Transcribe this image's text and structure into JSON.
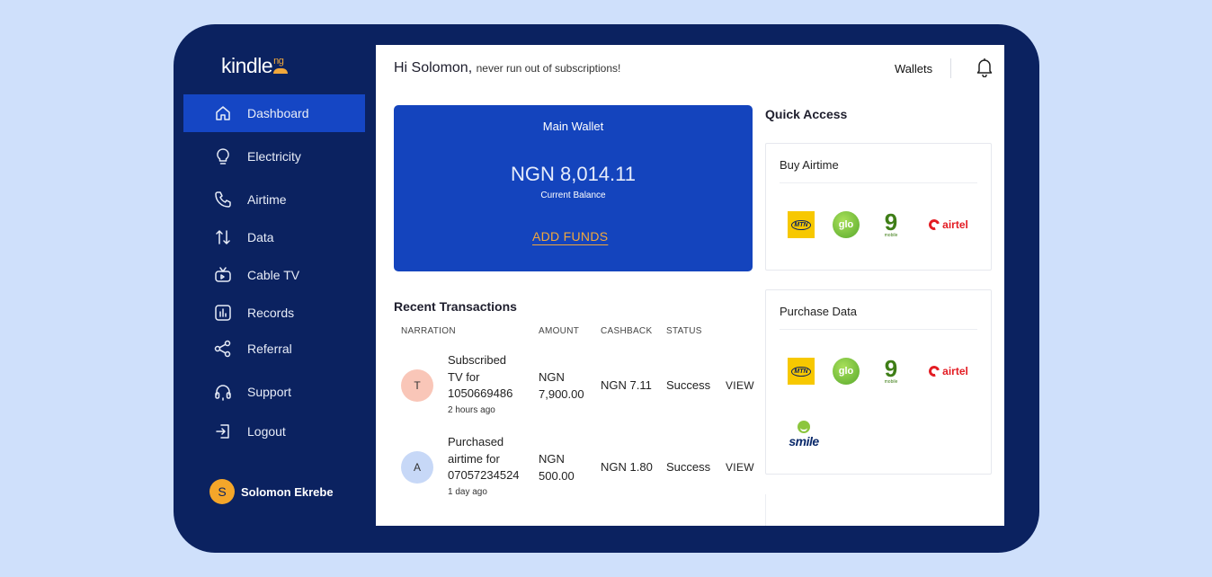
{
  "app": {
    "logo": "kindle",
    "logo_suffix": "ng"
  },
  "sidebar": {
    "items": [
      {
        "label": "Dashboard",
        "icon": "home-icon",
        "active": true
      },
      {
        "label": "Electricity",
        "icon": "lightbulb-icon"
      },
      {
        "label": "Airtime",
        "icon": "phone-icon"
      },
      {
        "label": "Data",
        "icon": "arrows-up-down-icon"
      },
      {
        "label": "Cable TV",
        "icon": "tv-icon"
      },
      {
        "label": "Records",
        "icon": "chart-box-icon"
      },
      {
        "label": "Referral",
        "icon": "share-icon"
      },
      {
        "label": "Support",
        "icon": "headset-icon"
      },
      {
        "label": "Logout",
        "icon": "logout-icon"
      }
    ],
    "user": {
      "initial": "S",
      "name": "Solomon Ekrebe"
    }
  },
  "header": {
    "greeting": "Hi Solomon,",
    "tagline": "never run out of subscriptions!",
    "wallets_label": "Wallets"
  },
  "wallet": {
    "title": "Main Wallet",
    "balance": "NGN 8,014.11",
    "balance_label": "Current Balance",
    "add_funds": "ADD FUNDS"
  },
  "transactions": {
    "title": "Recent Transactions",
    "columns": [
      "NARRATION",
      "AMOUNT",
      "CASHBACK",
      "STATUS"
    ],
    "rows": [
      {
        "initial": "T",
        "narration_lines": [
          "Subscribed",
          "TV for",
          "1050669486"
        ],
        "time": "2 hours ago",
        "amount_lines": [
          "NGN",
          "7,900.00"
        ],
        "cashback": "NGN 7.11",
        "status": "Success",
        "action": "VIEW"
      },
      {
        "initial": "A",
        "narration_lines": [
          "Purchased",
          "airtime for",
          "07057234524"
        ],
        "time": "1 day ago",
        "amount_lines": [
          "NGN",
          "500.00"
        ],
        "cashback": "NGN 1.80",
        "status": "Success",
        "action": "VIEW"
      }
    ]
  },
  "quick_access": {
    "title": "Quick Access",
    "buy_airtime": {
      "title": "Buy Airtime",
      "providers": [
        "MTN",
        "glo",
        "9mobile",
        "airtel"
      ]
    },
    "purchase_data": {
      "title": "Purchase Data",
      "providers": [
        "MTN",
        "glo",
        "9mobile",
        "airtel",
        "smile"
      ]
    }
  },
  "logo_text": {
    "mtn": "MTN",
    "glo": "glo",
    "nine": "9",
    "nine_sub": "mobile",
    "airtel": "airtel",
    "smile": "smile"
  },
  "colors": {
    "background": "#cfe0fb",
    "sidebar": "#0b2260",
    "active": "#1546c4",
    "wallet_card": "#1444bd",
    "accent": "#f2a83b"
  }
}
